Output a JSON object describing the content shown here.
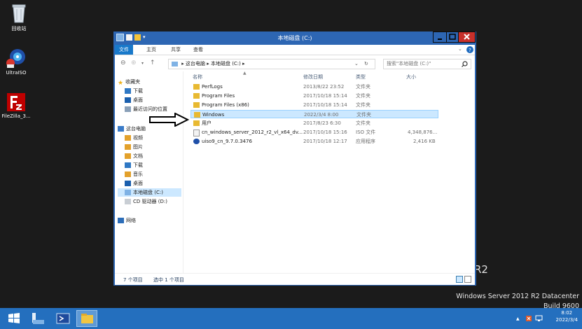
{
  "desktop": {
    "icons": [
      {
        "label": "回收站"
      },
      {
        "label": "UltraISO"
      },
      {
        "label": "FileZilla_3..."
      }
    ],
    "branding": {
      "r2": "R2",
      "edition": "Windows Server 2012 R2 Datacenter",
      "build": "Build 9600"
    }
  },
  "window": {
    "title": "本地磁盘 (C:)",
    "ribbon": {
      "tabs": [
        "文件",
        "主页",
        "共享",
        "查看"
      ]
    },
    "address": {
      "path": [
        "这台电脑",
        "本地磁盘 (C:)"
      ],
      "search_placeholder": "搜索\"本地磁盘 (C:)\""
    },
    "nav": {
      "favorites": "收藏夹",
      "fav_items": [
        "下载",
        "桌面",
        "最近访问的位置"
      ],
      "thispc": "这台电脑",
      "pc_items": [
        "视频",
        "图片",
        "文档",
        "下载",
        "音乐",
        "桌面",
        "本地磁盘 (C:)",
        "CD 驱动器 (D:)"
      ],
      "network": "网络"
    },
    "columns": {
      "name": "名称",
      "date": "修改日期",
      "type": "类型",
      "size": "大小"
    },
    "files": [
      {
        "name": "PerfLogs",
        "date": "2013/8/22 23:52",
        "type": "文件夹",
        "size": ""
      },
      {
        "name": "Program Files",
        "date": "2017/10/18 15:14",
        "type": "文件夹",
        "size": ""
      },
      {
        "name": "Program Files (x86)",
        "date": "2017/10/18 15:14",
        "type": "文件夹",
        "size": ""
      },
      {
        "name": "Windows",
        "date": "2022/3/4 8:00",
        "type": "文件夹",
        "size": ""
      },
      {
        "name": "用户",
        "date": "2017/8/23 6:30",
        "type": "文件夹",
        "size": ""
      },
      {
        "name": "cn_windows_server_2012_r2_vl_x64_dv...",
        "date": "2017/10/18 15:16",
        "type": "ISO 文件",
        "size": "4,348,876..."
      },
      {
        "name": "uiso9_cn_9.7.0.3476",
        "date": "2017/10/18 12:17",
        "type": "应用程序",
        "size": "2,416 KB"
      }
    ],
    "status": {
      "count": "7 个项目",
      "selected": "选中 1 个项目"
    }
  },
  "taskbar": {
    "time": "8:02",
    "date": "2022/3/4"
  },
  "colors": {
    "window_frame": "#2d66b3",
    "taskbar": "#246fbe",
    "desktop": "#1b1b1b",
    "close_button": "#c7302b",
    "selection": "#cce8ff",
    "folder": "#e8b931"
  }
}
